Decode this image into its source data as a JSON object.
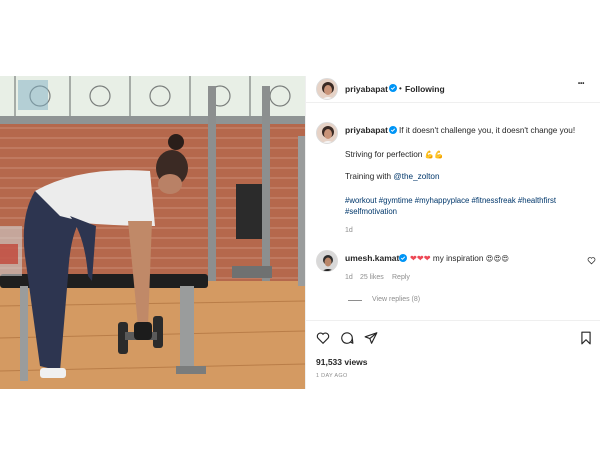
{
  "post": {
    "username": "priyabapat",
    "follow_status": "Following",
    "separator": "•",
    "more_label": "•••"
  },
  "caption": {
    "username": "priyabapat",
    "line1": "If it doesn't challenge you, it doesn't change you!",
    "line2": "Striving for perfection",
    "line2_emoji": "💪💪",
    "line3_prefix": "Training with",
    "line3_mention": "@the_zolton",
    "hashtags_line1": "#workout #gymtime #myhappyplace #fitnessfreak #healthfirst",
    "hashtags_line2": "#selfmotivation",
    "age": "1d"
  },
  "comment": {
    "username": "umesh.kamat",
    "hearts": "❤❤❤",
    "text": "my inspiration",
    "emoji": "😍😍😍",
    "age": "1d",
    "likes": "25 likes",
    "reply_label": "Reply",
    "view_replies": "View replies (8)"
  },
  "actions": {
    "views": "91,533 views",
    "time_ago": "1 DAY AGO"
  },
  "colors": {
    "verified": "#0095f6",
    "text": "#262626",
    "secondary": "#8e8e8e",
    "link": "#00376b",
    "heart": "#ed4956"
  },
  "icons": [
    "verified-badge-icon",
    "more-icon",
    "heart-icon",
    "comment-icon",
    "share-icon",
    "bookmark-icon"
  ]
}
